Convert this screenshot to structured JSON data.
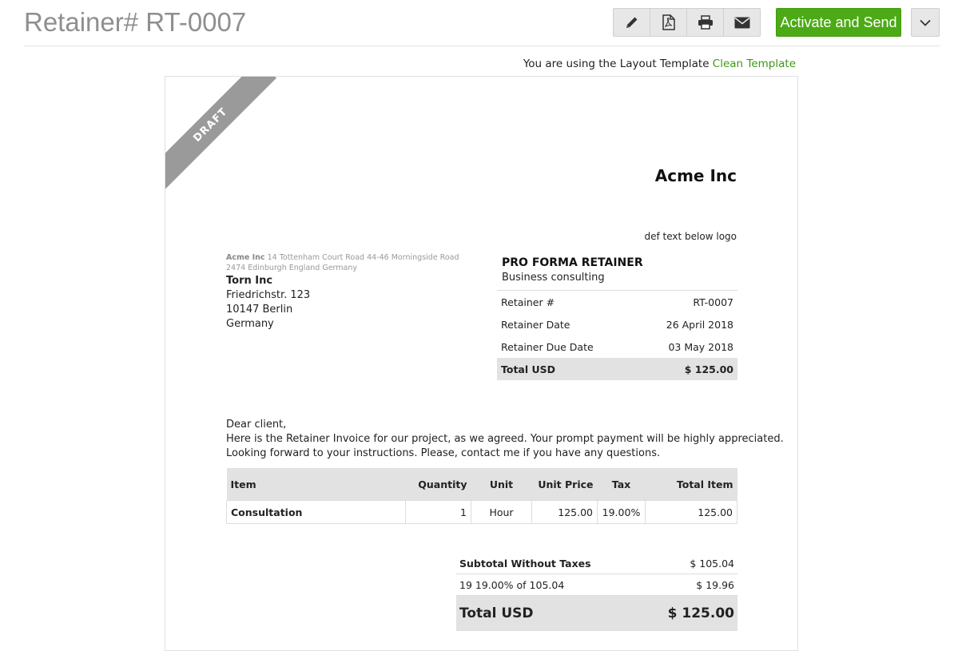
{
  "header": {
    "title": "Retainer# RT-0007",
    "actions": {
      "edit_icon": "pencil-icon",
      "pdf_icon": "pdf-file-icon",
      "print_icon": "printer-icon",
      "email_icon": "envelope-icon",
      "primary_label": "Activate and Send",
      "more_icon": "chevron-down-icon"
    },
    "accent_color": "#4caa16"
  },
  "template_note": {
    "prefix": "You are using the Layout Template",
    "link": "Clean Template"
  },
  "document": {
    "ribbon": "DRAFT",
    "org_name": "Acme Inc",
    "logo_text": "def text below logo",
    "sender": {
      "name": "Acme Inc",
      "address": "14 Tottenham Court Road 44-46 Morningside Road 2474 Edinburgh England Germany"
    },
    "client": {
      "name": "Torn Inc",
      "street": "Friedrichstr. 123",
      "city": "10147 Berlin",
      "country": "Germany"
    },
    "title": "PRO FORMA RETAINER",
    "subtitle": "Business consulting",
    "info": [
      {
        "label": "Retainer #",
        "value": "RT-0007"
      },
      {
        "label": "Retainer Date",
        "value": "26 April 2018"
      },
      {
        "label": "Retainer Due Date",
        "value": "03 May 2018"
      }
    ],
    "info_total": {
      "label": "Total USD",
      "value": "$ 125.00"
    },
    "letter": [
      "Dear client,",
      "Here is the Retainer Invoice for our project, as we agreed. Your prompt payment will be highly appreciated.",
      "Looking forward to your instructions. Please, contact me if you have any questions."
    ],
    "items_header": [
      "Item",
      "Quantity",
      "Unit",
      "Unit Price",
      "Tax",
      "Total Item"
    ],
    "items": [
      {
        "item": "Consultation",
        "quantity": "1",
        "unit": "Hour",
        "unit_price": "125.00",
        "tax": "19.00%",
        "total": "125.00"
      }
    ],
    "totals": [
      {
        "label": "Subtotal Without Taxes",
        "value": "$ 105.04"
      },
      {
        "label": "19 19.00% of 105.04",
        "value": "$ 19.96"
      }
    ],
    "grand_total": {
      "label": "Total USD",
      "value": "$ 125.00"
    }
  }
}
